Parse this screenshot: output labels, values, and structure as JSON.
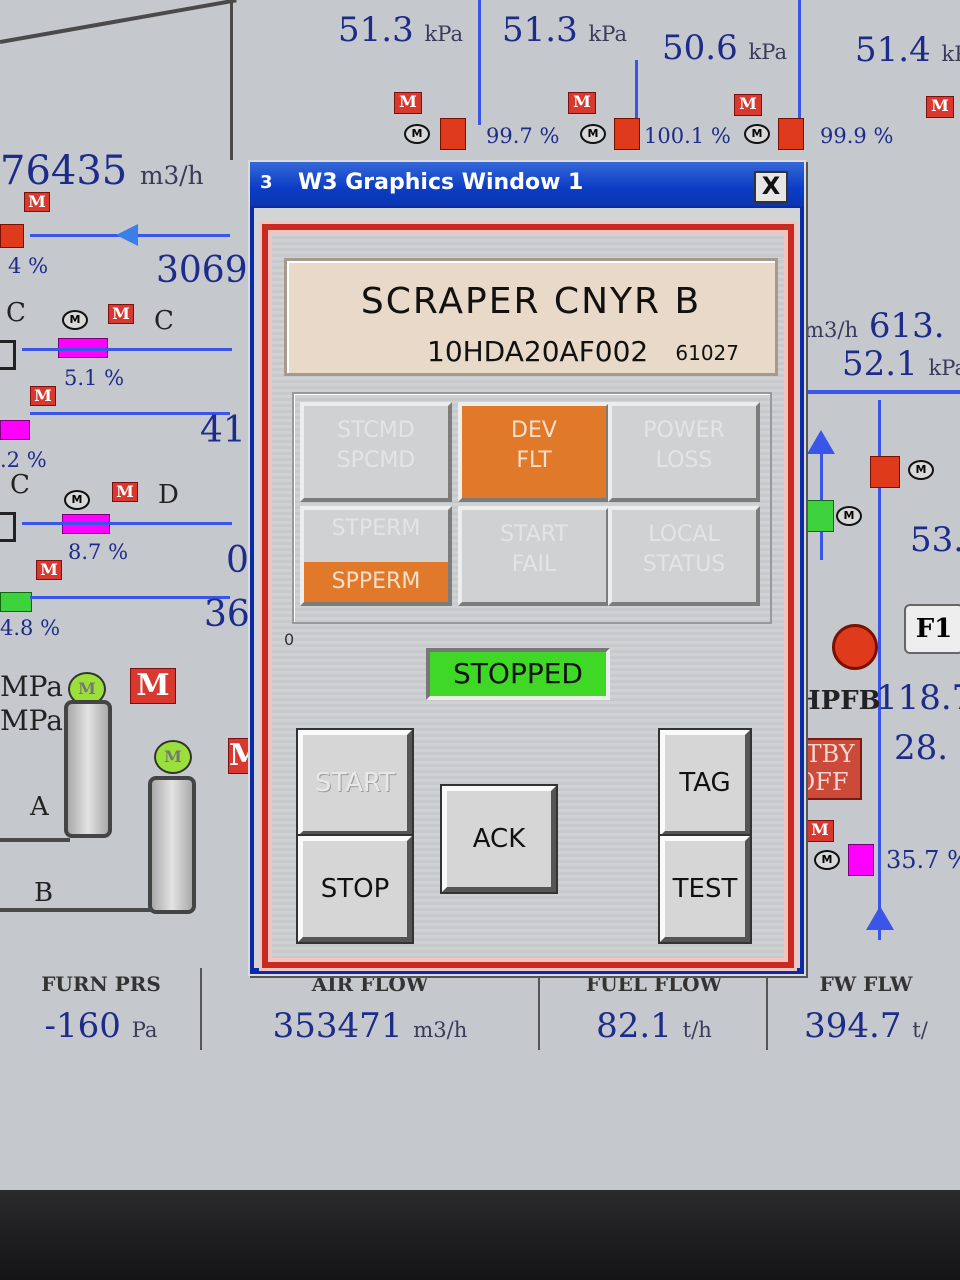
{
  "background": {
    "top_readings": [
      {
        "value": "51.3",
        "unit": "kPa"
      },
      {
        "value": "51.3",
        "unit": "kPa"
      },
      {
        "value": "50.6",
        "unit": "kPa"
      },
      {
        "value": "51.4",
        "unit": "kP"
      }
    ],
    "valve_pcts": [
      "99.7",
      "100.1",
      "99.9"
    ],
    "pct_sign": "%",
    "m_label": "M",
    "left_flow": {
      "value": "76435",
      "unit": "m3/h"
    },
    "left_value_3069": "3069",
    "left_pcts": [
      "4",
      "5.1",
      ".2",
      "8.7",
      "4.8"
    ],
    "left_numbers": [
      "41",
      "0",
      "36"
    ],
    "letters": [
      "C",
      "C",
      "C",
      "D",
      "A",
      "B"
    ],
    "mpa_labels": [
      "MPa",
      "MPa"
    ],
    "right_flow_unit": "m3/h",
    "right_flow_value": "613.",
    "right_kpa": {
      "value": "52.1",
      "unit": "kPa"
    },
    "right_53": "53.",
    "f1_label": "F1",
    "hpfb_label": "HPFB",
    "hpfb_value": "118.7",
    "right_28": "28.",
    "stby": [
      "STBY",
      "OFF"
    ],
    "right_pct": "35.7",
    "bottom": [
      {
        "label": "FURN PRS",
        "value": "-160",
        "unit": "Pa"
      },
      {
        "label": "AIR FLOW",
        "value": "353471",
        "unit": "m3/h"
      },
      {
        "label": "FUEL FLOW",
        "value": "82.1",
        "unit": "t/h"
      },
      {
        "label": "FW FLW",
        "value": "394.7",
        "unit": "t/"
      }
    ]
  },
  "window": {
    "icon": "3",
    "title": "W3 Graphics Window 1",
    "close": "X",
    "tag_name": "SCRAPER CNYR B",
    "tag_id": "10HDA20AF002",
    "tag_number": "61027",
    "status_tiles": {
      "stcmd": [
        "STCMD",
        "SPCMD"
      ],
      "devflt": [
        "DEV",
        "FLT"
      ],
      "power": [
        "POWER",
        "LOSS"
      ],
      "stperm": [
        "STPERM",
        "SPPERM"
      ],
      "startfail": [
        "START",
        "FAIL"
      ],
      "local": [
        "LOCAL",
        "STATUS"
      ]
    },
    "zero": "0",
    "state": "STOPPED",
    "buttons": {
      "start": "START",
      "stop": "STOP",
      "ack": "ACK",
      "tag": "TAG",
      "test": "TEST"
    }
  },
  "colors": {
    "accent_orange": "#e07a2a",
    "status_green": "#40d826",
    "frame_red": "#c72a20",
    "title_blue": "#0b3cc4"
  }
}
